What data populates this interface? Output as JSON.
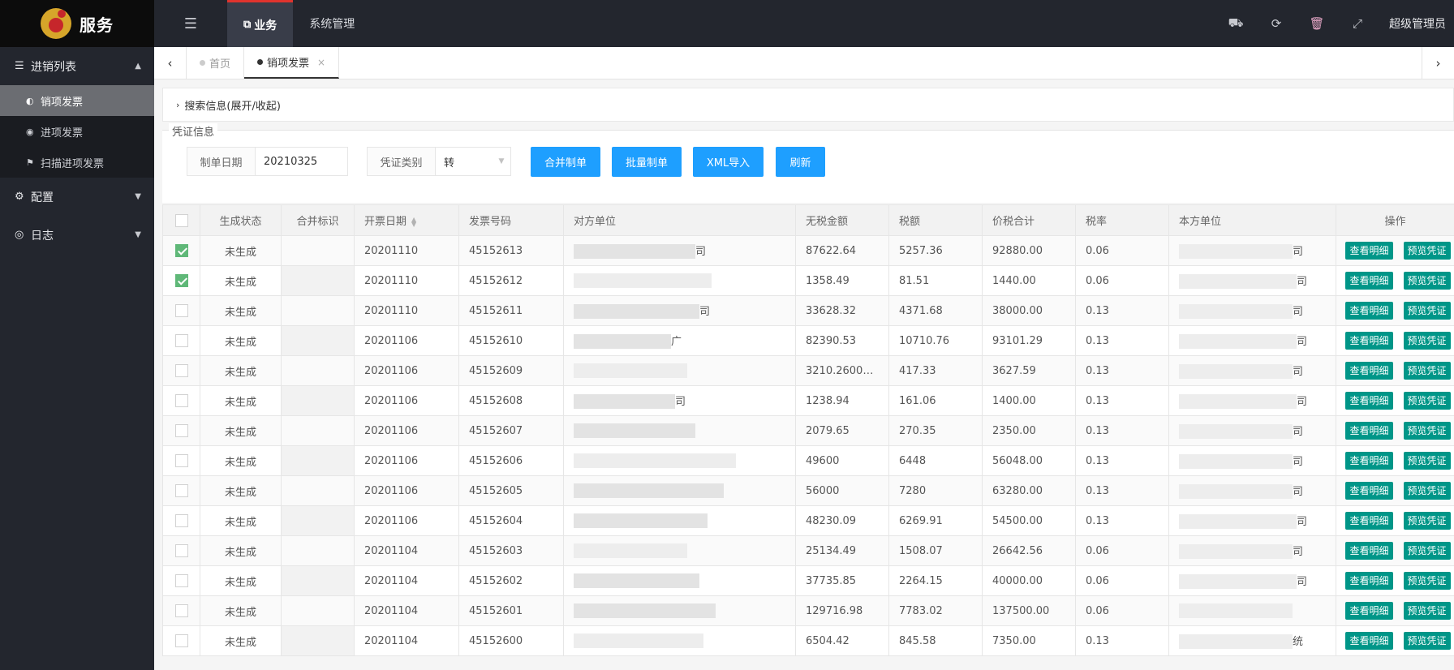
{
  "app": {
    "title": "服务"
  },
  "topnav": {
    "menu_icon": "list-icon",
    "tabs": [
      {
        "label": "业务",
        "active": true
      },
      {
        "label": "系统管理",
        "active": false
      }
    ]
  },
  "topright": {
    "tools": [
      "truck-icon",
      "refresh-icon",
      "trash-icon",
      "fullscreen-icon"
    ],
    "user": "超级管理员"
  },
  "sidebar": {
    "groups": [
      {
        "label": "进销列表",
        "icon": "list-icon",
        "expanded": true,
        "items": [
          {
            "label": "销项发票",
            "active": true
          },
          {
            "label": "进项发票",
            "active": false
          },
          {
            "label": "扫描进项发票",
            "active": false
          }
        ]
      },
      {
        "label": "配置",
        "icon": "gears-icon",
        "expanded": false
      },
      {
        "label": "日志",
        "icon": "globe-icon",
        "expanded": false
      }
    ]
  },
  "tabbar": {
    "tabs": [
      {
        "label": "首页",
        "active": false
      },
      {
        "label": "销项发票",
        "active": true,
        "close": "×"
      }
    ]
  },
  "search": {
    "toggle_label": "搜索信息(展开/收起)"
  },
  "voucher": {
    "legend": "凭证信息",
    "date_label": "制单日期",
    "date_value": "20210325",
    "type_label": "凭证类别",
    "type_value": "转",
    "buttons": [
      "合并制单",
      "批量制单",
      "XML导入",
      "刷新"
    ]
  },
  "table": {
    "columns": [
      "",
      "生成状态",
      "合并标识",
      "开票日期",
      "发票号码",
      "对方单位",
      "无税金额",
      "税额",
      "价税合计",
      "税率",
      "本方单位",
      "操作"
    ],
    "op_buttons": [
      "查看明细",
      "预览凭证"
    ],
    "rows": [
      {
        "checked": true,
        "status": "未生成",
        "merge": "",
        "date": "20201110",
        "invoice": "45152613",
        "partner": "司",
        "net": "87622.64",
        "tax": "5257.36",
        "total": "92880.00",
        "rate": "0.06",
        "own": "司"
      },
      {
        "checked": true,
        "status": "未生成",
        "merge": "",
        "date": "20201110",
        "invoice": "45152612",
        "partner": "",
        "net": "1358.49",
        "tax": "81.51",
        "total": "1440.00",
        "rate": "0.06",
        "own": "司"
      },
      {
        "checked": false,
        "status": "未生成",
        "merge": "",
        "date": "20201110",
        "invoice": "45152611",
        "partner": "司",
        "net": "33628.32",
        "tax": "4371.68",
        "total": "38000.00",
        "rate": "0.13",
        "own": "司"
      },
      {
        "checked": false,
        "status": "未生成",
        "merge": "",
        "date": "20201106",
        "invoice": "45152610",
        "partner": "广",
        "net": "82390.53",
        "tax": "10710.76",
        "total": "93101.29",
        "rate": "0.13",
        "own": "司"
      },
      {
        "checked": false,
        "status": "未生成",
        "merge": "",
        "date": "20201106",
        "invoice": "45152609",
        "partner": "",
        "net": "3210.26000...",
        "tax": "417.33",
        "total": "3627.59",
        "rate": "0.13",
        "own": "司"
      },
      {
        "checked": false,
        "status": "未生成",
        "merge": "",
        "date": "20201106",
        "invoice": "45152608",
        "partner": "司",
        "net": "1238.94",
        "tax": "161.06",
        "total": "1400.00",
        "rate": "0.13",
        "own": "司"
      },
      {
        "checked": false,
        "status": "未生成",
        "merge": "",
        "date": "20201106",
        "invoice": "45152607",
        "partner": "",
        "net": "2079.65",
        "tax": "270.35",
        "total": "2350.00",
        "rate": "0.13",
        "own": "司"
      },
      {
        "checked": false,
        "status": "未生成",
        "merge": "",
        "date": "20201106",
        "invoice": "45152606",
        "partner": "",
        "net": "49600",
        "tax": "6448",
        "total": "56048.00",
        "rate": "0.13",
        "own": "司"
      },
      {
        "checked": false,
        "status": "未生成",
        "merge": "",
        "date": "20201106",
        "invoice": "45152605",
        "partner": "",
        "net": "56000",
        "tax": "7280",
        "total": "63280.00",
        "rate": "0.13",
        "own": "司"
      },
      {
        "checked": false,
        "status": "未生成",
        "merge": "",
        "date": "20201106",
        "invoice": "45152604",
        "partner": "",
        "net": "48230.09",
        "tax": "6269.91",
        "total": "54500.00",
        "rate": "0.13",
        "own": "司"
      },
      {
        "checked": false,
        "status": "未生成",
        "merge": "",
        "date": "20201104",
        "invoice": "45152603",
        "partner": "",
        "net": "25134.49",
        "tax": "1508.07",
        "total": "26642.56",
        "rate": "0.06",
        "own": "司"
      },
      {
        "checked": false,
        "status": "未生成",
        "merge": "",
        "date": "20201104",
        "invoice": "45152602",
        "partner": "",
        "net": "37735.85",
        "tax": "2264.15",
        "total": "40000.00",
        "rate": "0.06",
        "own": "司"
      },
      {
        "checked": false,
        "status": "未生成",
        "merge": "",
        "date": "20201104",
        "invoice": "45152601",
        "partner": "",
        "net": "129716.98",
        "tax": "7783.02",
        "total": "137500.00",
        "rate": "0.06",
        "own": ""
      },
      {
        "checked": false,
        "status": "未生成",
        "merge": "",
        "date": "20201104",
        "invoice": "45152600",
        "partner": "",
        "net": "6504.42",
        "tax": "845.58",
        "total": "7350.00",
        "rate": "0.13",
        "own": "统"
      }
    ]
  },
  "colors": {
    "primary": "#1e9fff",
    "teal": "#009688",
    "check": "#5fb878",
    "dark": "#23262e",
    "accent": "#e0332d"
  }
}
